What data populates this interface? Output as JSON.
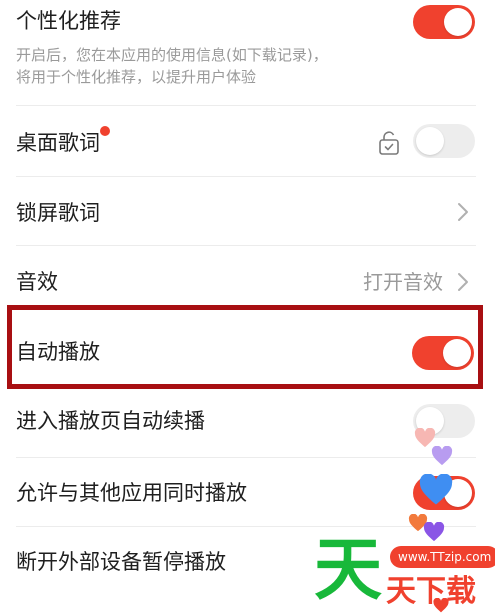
{
  "settings": {
    "personalized": {
      "title": "个性化推荐",
      "desc_line1": "开启后，您在本应用的使用信息(如下载记录)，",
      "desc_line2": "将用于个性化推荐，以提升用户体验",
      "toggle_on": true
    },
    "desktop_lyrics": {
      "title": "桌面歌词",
      "has_badge": true,
      "lock_icon": "unlock-icon",
      "toggle_on": false
    },
    "lockscreen_lyrics": {
      "title": "锁屏歌词"
    },
    "sound_effects": {
      "title": "音效",
      "value": "打开音效"
    },
    "autoplay": {
      "title": "自动播放",
      "toggle_on": true
    },
    "continue_play": {
      "title": "进入播放页自动续播",
      "toggle_on": false
    },
    "allow_simultaneous": {
      "title": "允许与其他应用同时播放",
      "toggle_on": true
    },
    "pause_on_disconnect": {
      "title": "断开外部设备暂停播放"
    }
  },
  "watermark": {
    "url": "www.TTzip.com",
    "big_char": "天",
    "small_text": "天下载"
  },
  "colors": {
    "accent": "#f0412e",
    "highlight_border": "#a80f12",
    "toggle_off": "#ededed",
    "secondary_text": "#9a9a9a"
  }
}
